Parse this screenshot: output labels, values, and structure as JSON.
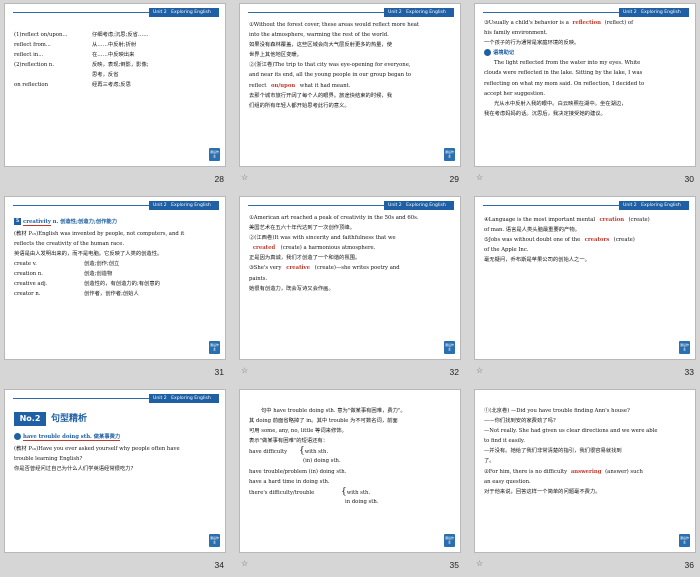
{
  "header_label": "Unit 2   Exploring English",
  "corner_label": "课后作业",
  "slides": [
    {
      "page": "28",
      "lines": [
        {
          "a": "(1)reflect on/upon...",
          "b": "仔细考虑;沉思;反省……"
        },
        {
          "a": "reflect from...",
          "b": "从……中反射;折射"
        },
        {
          "a": "reflect in...",
          "b": "在……中反映出来"
        },
        {
          "a": "(2)reflection n.",
          "b": "反映，表现;倒影，影像;"
        },
        {
          "a": "",
          "b": "思考，反省"
        },
        {
          "a": "on reflection",
          "b": "经再三考虑;反思"
        }
      ]
    },
    {
      "page": "29",
      "lines": [
        "①Without the forest cover, these areas would reflect more heat",
        "into the atmosphere, warming the rest of the world.",
        "如果没有森林覆盖，这些区域会向大气层反射更多的热量，使",
        "世界上其他地区变暖。",
        "②(浙江卷)The trip to that city was eye-opening for everyone,",
        "and near its end, all the young people in our group began to",
        "reflect ____ what it had meant.",
        "去那个城市旅行开阔了每个人的眼界。旅途快结束的时候，我",
        "们组的所有年轻人都开始思考此行的意义。"
      ],
      "answer": "on/upon"
    },
    {
      "page": "30",
      "lines_a": [
        "③Usually a child's behavior is a ____ (reflect) of",
        "his family environment.",
        "一个孩子的行为通常是家庭环境的反映。"
      ],
      "answer": "reflection",
      "memo_title": "语境助记",
      "lines_b": [
        "The light reflected from the water into my eyes. White",
        "clouds were reflected in the lake. Sitting by the lake, I was",
        "reflecting on what my mom said. On reflection, I decided to",
        "accept her suggestion.",
        "光从水中反射入我的眼中。白云映照在湖中。坐在湖边，",
        "我在考虑妈妈的话。沉思后，我决定接受她的建议。"
      ]
    },
    {
      "page": "31",
      "title_word": "creativity",
      "title_rest": "n. 创造性;创造力;创作能力",
      "lines": [
        "(教材 P₁₅)English was invented by people, not computers, and it",
        "reflects the creativity of the human race.",
        "英语是由人发明出来的，而不是电脑。它反映了人类的创造性。"
      ],
      "pairs": [
        {
          "a": "create v.",
          "b": "创造;创作;创立"
        },
        {
          "a": "creation n.",
          "b": "创造;创造物"
        },
        {
          "a": "creative adj.",
          "b": "创造性的，有创造力的;有创意的"
        },
        {
          "a": "creator n.",
          "b": "创作者，创作者;创始人"
        }
      ]
    },
    {
      "page": "32",
      "lines": [
        "①American art reached a peak of creativity in the 50s and 60s.",
        "美国艺术在五六十年代达到了一次创作顶峰。",
        "②(江西卷)It was with sincerity and faithfulness that we",
        "____ (create) a harmonious atmosphere.",
        "正是因为真诚，我们才创造了一个和谐的氛围。",
        "③She's very ____ (create)—she writes poetry and",
        "paints.",
        "她很有创造力，既会写诗又会作画。"
      ],
      "answers": [
        "created",
        "creative"
      ]
    },
    {
      "page": "33",
      "lines": [
        "④Language is the most important mental ____ (create)",
        "of man. 语言是人类头脑最重要的产物。",
        "⑤Jobs was without doubt one of the ____ (create)",
        "of the Apple Inc.",
        "毫无疑问，乔布斯是苹果公司的创始人之一。"
      ],
      "answers": [
        "creation",
        "creators"
      ]
    },
    {
      "page": "34",
      "section_no": "No.2",
      "section_title": "句型精析",
      "topic": "have trouble doing sth.  做某事费力",
      "lines": [
        "(教材 P₁₆)Have you ever asked yourself why people often have",
        "trouble learning English?",
        "你是否曾经问过自己为什么人们学英语经常很吃力?"
      ]
    },
    {
      "page": "35",
      "lines": [
        "句中 have trouble doing sth. 意为\"做某事有困难，费力\"。",
        "其 doing 前面省略掉了 in。其中 trouble 为不可数名词，前面",
        "可用 some, any, no, little 等词来修饰。",
        "表示\"做某事有困难\"的短语还有："
      ],
      "structs": [
        {
          "a": "have difficulty",
          "b": "with sth.",
          "c": "(in) doing sth."
        },
        {
          "a": "have trouble/problem (in) doing sth.",
          "b": "",
          "c": ""
        },
        {
          "a": "have a hard time in doing sth.",
          "b": "",
          "c": ""
        },
        {
          "a": "there's difficulty/trouble",
          "b": "with sth.",
          "c": "in doing sth."
        }
      ]
    },
    {
      "page": "36",
      "lines": [
        "①(北京卷) —Did you have trouble finding Ann's house?",
        "——你们找到安的家费劲了吗?",
        "—Not really. She had given us clear directions and we were able",
        "to find it easily.",
        "—并没有。她给了我们非常清楚的指引，我们很容易就找到",
        "了。",
        "②For him, there is no difficulty ____ (answer) such",
        "an easy question.",
        "对于他来说，回答这样一个简单的问题毫不费力。"
      ],
      "answer": "answering"
    }
  ]
}
